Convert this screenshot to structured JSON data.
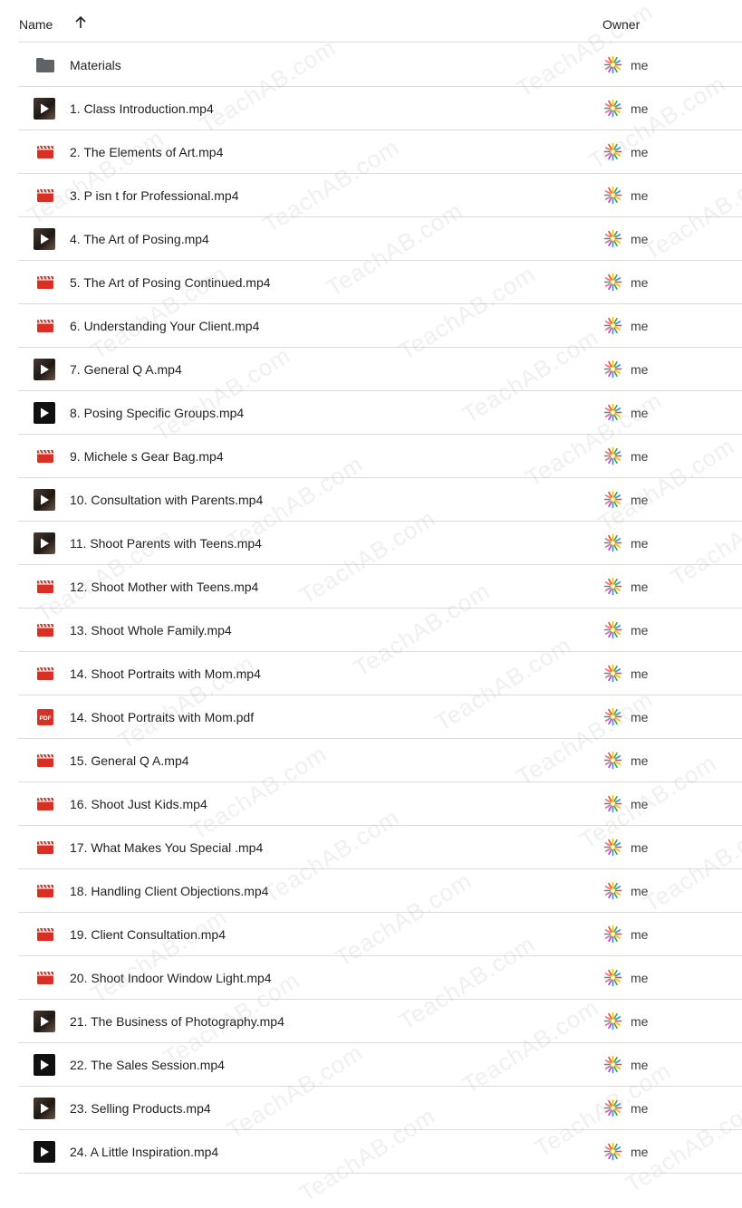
{
  "header": {
    "name_label": "Name",
    "owner_label": "Owner"
  },
  "watermark": "TeachAB.com",
  "colors": {
    "video_red": "#d93025",
    "folder_gray": "#5f6368",
    "divider": "#dadce0"
  },
  "files": [
    {
      "name": "Materials",
      "type": "folder",
      "owner": "me"
    },
    {
      "name": "1. Class Introduction.mp4",
      "type": "video-thumb",
      "owner": "me"
    },
    {
      "name": "2. The Elements of Art.mp4",
      "type": "video",
      "owner": "me"
    },
    {
      "name": "3. P isn t for Professional.mp4",
      "type": "video",
      "owner": "me"
    },
    {
      "name": "4. The Art of Posing.mp4",
      "type": "video-thumb",
      "owner": "me"
    },
    {
      "name": "5. The Art of Posing Continued.mp4",
      "type": "video",
      "owner": "me"
    },
    {
      "name": "6. Understanding Your Client.mp4",
      "type": "video",
      "owner": "me"
    },
    {
      "name": "7. General Q A.mp4",
      "type": "video-thumb",
      "owner": "me"
    },
    {
      "name": "8. Posing Specific Groups.mp4",
      "type": "video-thumb-dark",
      "owner": "me"
    },
    {
      "name": "9. Michele s Gear Bag.mp4",
      "type": "video",
      "owner": "me"
    },
    {
      "name": "10. Consultation with Parents.mp4",
      "type": "video-thumb",
      "owner": "me"
    },
    {
      "name": "11. Shoot Parents with Teens.mp4",
      "type": "video-thumb",
      "owner": "me"
    },
    {
      "name": "12. Shoot Mother with Teens.mp4",
      "type": "video",
      "owner": "me"
    },
    {
      "name": "13. Shoot Whole Family.mp4",
      "type": "video",
      "owner": "me"
    },
    {
      "name": "14. Shoot Portraits with Mom.mp4",
      "type": "video",
      "owner": "me"
    },
    {
      "name": "14. Shoot Portraits with Mom.pdf",
      "type": "pdf",
      "owner": "me"
    },
    {
      "name": "15. General Q A.mp4",
      "type": "video",
      "owner": "me"
    },
    {
      "name": "16. Shoot Just Kids.mp4",
      "type": "video",
      "owner": "me"
    },
    {
      "name": "17. What Makes You Special .mp4",
      "type": "video",
      "owner": "me"
    },
    {
      "name": "18. Handling Client Objections.mp4",
      "type": "video",
      "owner": "me"
    },
    {
      "name": "19. Client Consultation.mp4",
      "type": "video",
      "owner": "me"
    },
    {
      "name": "20. Shoot Indoor Window Light.mp4",
      "type": "video",
      "owner": "me"
    },
    {
      "name": "21. The Business of Photography.mp4",
      "type": "video-thumb",
      "owner": "me"
    },
    {
      "name": "22. The Sales Session.mp4",
      "type": "video-thumb-dark",
      "owner": "me"
    },
    {
      "name": "23. Selling Products.mp4",
      "type": "video-thumb",
      "owner": "me"
    },
    {
      "name": "24. A Little Inspiration.mp4",
      "type": "video-thumb-dark",
      "owner": "me"
    }
  ]
}
